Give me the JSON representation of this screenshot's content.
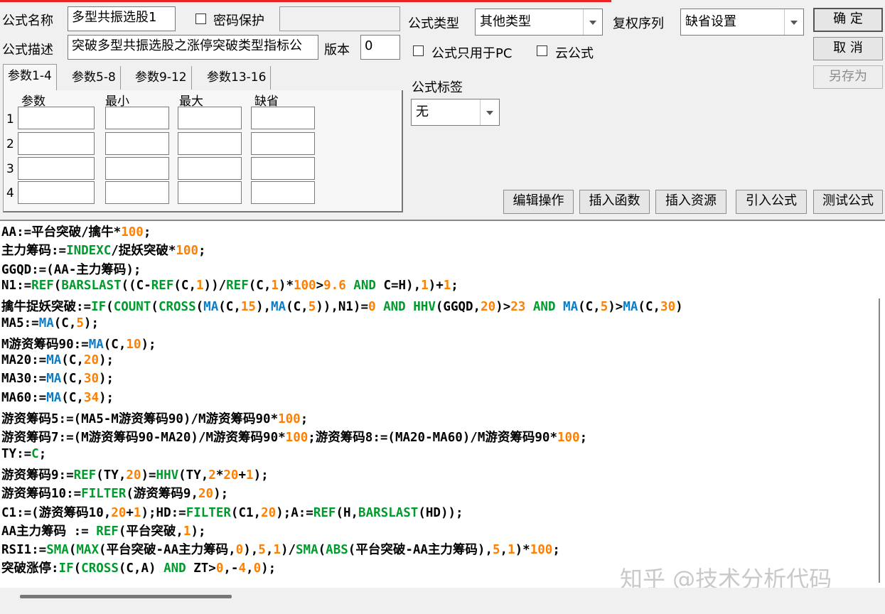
{
  "header": {
    "name_label": "公式名称",
    "name_value": "多型共振选股1",
    "password_label": "密码保护",
    "type_label": "公式类型",
    "type_value": "其他类型",
    "rights_label": "复权序列",
    "rights_value": "缺省设置",
    "desc_label": "公式描述",
    "desc_value": "突破多型共振选股之涨停突破类型指标公",
    "version_label": "版本",
    "version_value": "0",
    "pc_only_label": "公式只用于PC",
    "cloud_label": "云公式",
    "tag_label": "公式标签",
    "tag_value": "无"
  },
  "buttons": {
    "ok": "确  定",
    "cancel": "取  消",
    "save_as": "另存为",
    "edit": "编辑操作",
    "insert_func": "插入函数",
    "insert_res": "插入资源",
    "import": "引入公式",
    "test": "测试公式"
  },
  "tabs": [
    "参数1-4",
    "参数5-8",
    "参数9-12",
    "参数13-16"
  ],
  "params": {
    "headers": [
      "参数",
      "最小",
      "最大",
      "缺省"
    ],
    "rows": [
      "1",
      "2",
      "3",
      "4"
    ]
  },
  "code_lines": [
    [
      [
        "AA:=平台突破/擒牛*",
        "k"
      ],
      [
        "100",
        "o"
      ],
      [
        ";",
        "k"
      ]
    ],
    [
      [
        "主力筹码:=",
        "k"
      ],
      [
        "INDEXC",
        "g"
      ],
      [
        "/捉妖突破*",
        "k"
      ],
      [
        "100",
        "o"
      ],
      [
        ";",
        "k"
      ]
    ],
    [
      [
        "GGQD:=(AA-主力筹码);",
        "k"
      ]
    ],
    [
      [
        "N1:=",
        "k"
      ],
      [
        "REF",
        "g"
      ],
      [
        "(",
        "k"
      ],
      [
        "BARSLAST",
        "g"
      ],
      [
        "((C-",
        "k"
      ],
      [
        "REF",
        "g"
      ],
      [
        "(C,",
        "k"
      ],
      [
        "1",
        "o"
      ],
      [
        "))/",
        "k"
      ],
      [
        "REF",
        "g"
      ],
      [
        "(C,",
        "k"
      ],
      [
        "1",
        "o"
      ],
      [
        ")*",
        "k"
      ],
      [
        "100",
        "o"
      ],
      [
        ">",
        "k"
      ],
      [
        "9.6",
        "o"
      ],
      [
        " ",
        "k"
      ],
      [
        "AND",
        "g"
      ],
      [
        " C=H),",
        "k"
      ],
      [
        "1",
        "o"
      ],
      [
        ")+",
        "k"
      ],
      [
        "1",
        "o"
      ],
      [
        ";",
        "k"
      ]
    ],
    [
      [
        "擒牛捉妖突破:=",
        "k"
      ],
      [
        "IF",
        "g"
      ],
      [
        "(",
        "k"
      ],
      [
        "COUNT",
        "g"
      ],
      [
        "(",
        "k"
      ],
      [
        "CROSS",
        "g"
      ],
      [
        "(",
        "k"
      ],
      [
        "MA",
        "b"
      ],
      [
        "(C,",
        "k"
      ],
      [
        "15",
        "o"
      ],
      [
        "),",
        "k"
      ],
      [
        "MA",
        "b"
      ],
      [
        "(C,",
        "k"
      ],
      [
        "5",
        "o"
      ],
      [
        ")),N1)=",
        "k"
      ],
      [
        "0",
        "o"
      ],
      [
        " ",
        "k"
      ],
      [
        "AND",
        "g"
      ],
      [
        " ",
        "k"
      ],
      [
        "HHV",
        "g"
      ],
      [
        "(GGQD,",
        "k"
      ],
      [
        "20",
        "o"
      ],
      [
        ")>",
        "k"
      ],
      [
        "23",
        "o"
      ],
      [
        " ",
        "k"
      ],
      [
        "AND",
        "g"
      ],
      [
        " ",
        "k"
      ],
      [
        "MA",
        "b"
      ],
      [
        "(C,",
        "k"
      ],
      [
        "5",
        "o"
      ],
      [
        ")>",
        "k"
      ],
      [
        "MA",
        "b"
      ],
      [
        "(C,",
        "k"
      ],
      [
        "30",
        "o"
      ],
      [
        ")",
        "k"
      ]
    ],
    [
      [
        "MA5:=",
        "k"
      ],
      [
        "MA",
        "b"
      ],
      [
        "(C,",
        "k"
      ],
      [
        "5",
        "o"
      ],
      [
        ");",
        "k"
      ]
    ],
    [
      [
        "M游资筹码90:=",
        "k"
      ],
      [
        "MA",
        "b"
      ],
      [
        "(C,",
        "k"
      ],
      [
        "10",
        "o"
      ],
      [
        ");",
        "k"
      ]
    ],
    [
      [
        "MA20:=",
        "k"
      ],
      [
        "MA",
        "b"
      ],
      [
        "(C,",
        "k"
      ],
      [
        "20",
        "o"
      ],
      [
        ");",
        "k"
      ]
    ],
    [
      [
        "MA30:=",
        "k"
      ],
      [
        "MA",
        "b"
      ],
      [
        "(C,",
        "k"
      ],
      [
        "30",
        "o"
      ],
      [
        ");",
        "k"
      ]
    ],
    [
      [
        "MA60:=",
        "k"
      ],
      [
        "MA",
        "b"
      ],
      [
        "(C,",
        "k"
      ],
      [
        "34",
        "o"
      ],
      [
        ");",
        "k"
      ]
    ],
    [
      [
        "游资筹码5:=(MA5-M游资筹码90)/M游资筹码90*",
        "k"
      ],
      [
        "100",
        "o"
      ],
      [
        ";",
        "k"
      ]
    ],
    [
      [
        "游资筹码7:=(M游资筹码90-MA20)/M游资筹码90*",
        "k"
      ],
      [
        "100",
        "o"
      ],
      [
        ";游资筹码8:=(MA20-MA60)/M游资筹码90*",
        "k"
      ],
      [
        "100",
        "o"
      ],
      [
        ";",
        "k"
      ]
    ],
    [
      [
        "TY:=",
        "k"
      ],
      [
        "C",
        "g"
      ],
      [
        ";",
        "k"
      ]
    ],
    [
      [
        "游资筹码9:=",
        "k"
      ],
      [
        "REF",
        "g"
      ],
      [
        "(TY,",
        "k"
      ],
      [
        "20",
        "o"
      ],
      [
        ")=",
        "k"
      ],
      [
        "HHV",
        "g"
      ],
      [
        "(TY,",
        "k"
      ],
      [
        "2",
        "o"
      ],
      [
        "*",
        "k"
      ],
      [
        "20",
        "o"
      ],
      [
        "+",
        "k"
      ],
      [
        "1",
        "o"
      ],
      [
        ");",
        "k"
      ]
    ],
    [
      [
        "游资筹码10:=",
        "k"
      ],
      [
        "FILTER",
        "g"
      ],
      [
        "(游资筹码9,",
        "k"
      ],
      [
        "20",
        "o"
      ],
      [
        ");",
        "k"
      ]
    ],
    [
      [
        "C1:=(游资筹码10,",
        "k"
      ],
      [
        "20",
        "o"
      ],
      [
        "+",
        "k"
      ],
      [
        "1",
        "o"
      ],
      [
        ");HD:=",
        "k"
      ],
      [
        "FILTER",
        "g"
      ],
      [
        "(C1,",
        "k"
      ],
      [
        "20",
        "o"
      ],
      [
        ");A:=",
        "k"
      ],
      [
        "REF",
        "g"
      ],
      [
        "(H,",
        "k"
      ],
      [
        "BARSLAST",
        "g"
      ],
      [
        "(HD));",
        "k"
      ]
    ],
    [
      [
        "AA主力筹码 := ",
        "k"
      ],
      [
        "REF",
        "g"
      ],
      [
        "(平台突破,",
        "k"
      ],
      [
        "1",
        "o"
      ],
      [
        ");",
        "k"
      ]
    ],
    [
      [
        "RSI1:=",
        "k"
      ],
      [
        "SMA",
        "g"
      ],
      [
        "(",
        "k"
      ],
      [
        "MAX",
        "g"
      ],
      [
        "(平台突破-AA主力筹码,",
        "k"
      ],
      [
        "0",
        "o"
      ],
      [
        "),",
        "k"
      ],
      [
        "5",
        "o"
      ],
      [
        ",",
        "k"
      ],
      [
        "1",
        "o"
      ],
      [
        ")/",
        "k"
      ],
      [
        "SMA",
        "g"
      ],
      [
        "(",
        "k"
      ],
      [
        "ABS",
        "g"
      ],
      [
        "(平台突破-AA主力筹码),",
        "k"
      ],
      [
        "5",
        "o"
      ],
      [
        ",",
        "k"
      ],
      [
        "1",
        "o"
      ],
      [
        ")*",
        "k"
      ],
      [
        "100",
        "o"
      ],
      [
        ";",
        "k"
      ]
    ],
    [
      [
        "突破涨停:",
        "k"
      ],
      [
        "IF",
        "g"
      ],
      [
        "(",
        "k"
      ],
      [
        "CROSS",
        "g"
      ],
      [
        "(C,A) ",
        "k"
      ],
      [
        "AND",
        "g"
      ],
      [
        " ZT>",
        "k"
      ],
      [
        "0",
        "o"
      ],
      [
        ",-",
        "k"
      ],
      [
        "4",
        "o"
      ],
      [
        ",",
        "k"
      ],
      [
        "0",
        "o"
      ],
      [
        ");",
        "k"
      ]
    ]
  ],
  "watermark": "知乎 @技术分析代码",
  "colors": {
    "function": "#009a2d",
    "ma_function": "#0a7dc8",
    "number": "#ff7f00"
  }
}
